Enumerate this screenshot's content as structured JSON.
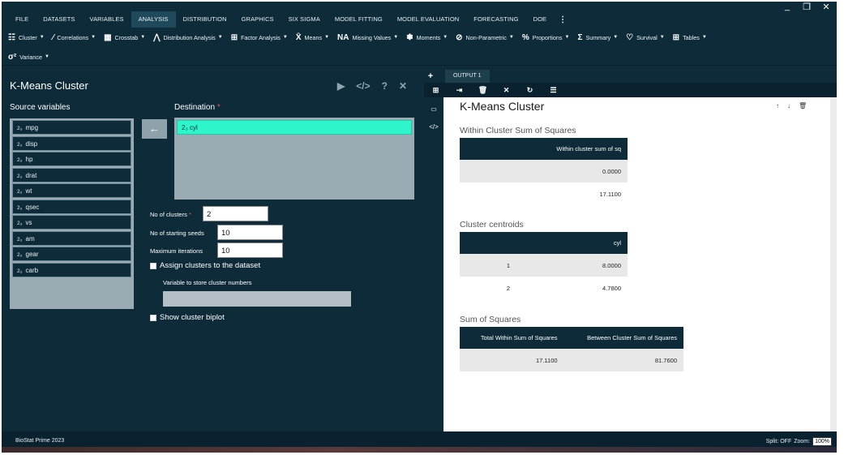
{
  "window_controls": {
    "minimize": "_",
    "maximize": "❐",
    "close": "✕"
  },
  "menu": {
    "items": [
      "FILE",
      "DATASETS",
      "VARIABLES",
      "ANALYSIS",
      "DISTRIBUTION",
      "GRAPHICS",
      "SIX SIGMA",
      "MODEL FITTING",
      "MODEL EVALUATION",
      "FORECASTING",
      "DOE"
    ],
    "active": "ANALYSIS",
    "more": "⋮"
  },
  "ribbon": {
    "row1": [
      {
        "icon": "☷",
        "icon_name": "cluster-icon",
        "label": "Cluster"
      },
      {
        "icon": "∕",
        "icon_name": "correlations-icon",
        "label": "Correlations"
      },
      {
        "icon": "▦",
        "icon_name": "crosstab-icon",
        "label": "Crosstab"
      },
      {
        "icon": "⋀",
        "icon_name": "distribution-analysis-icon",
        "label": "Distribution Analysis"
      },
      {
        "icon": "⊞",
        "icon_name": "factor-analysis-icon",
        "label": "Factor Analysis"
      },
      {
        "icon": "X̄",
        "icon_name": "means-icon",
        "label": "Means"
      },
      {
        "icon": "NA",
        "icon_name": "missing-values-icon",
        "label": "Missing Values"
      },
      {
        "icon": "✽",
        "icon_name": "moments-icon",
        "label": "Moments"
      },
      {
        "icon": "⊘",
        "icon_name": "non-parametric-icon",
        "label": "Non-Parametric"
      },
      {
        "icon": "%",
        "icon_name": "proportions-icon",
        "label": "Proportions"
      },
      {
        "icon": "Σ",
        "icon_name": "summary-icon",
        "label": "Summary"
      },
      {
        "icon": "♡",
        "icon_name": "survival-icon",
        "label": "Survival"
      },
      {
        "icon": "⊞",
        "icon_name": "tables-icon",
        "label": "Tables"
      }
    ],
    "row2": [
      {
        "icon": "σ²",
        "icon_name": "variance-icon",
        "label": "Variance"
      }
    ]
  },
  "dialog": {
    "title": "K-Means Cluster",
    "tools": {
      "run": "▶",
      "code": "</>",
      "help": "?",
      "close": "✕"
    },
    "source_label": "Source variables",
    "destination_label": "Destination",
    "required_mark": "*",
    "var_icon": "2₃",
    "source_variables": [
      "mpg",
      "disp",
      "hp",
      "drat",
      "wt",
      "qsec",
      "vs",
      "am",
      "gear",
      "carb"
    ],
    "destination_variables": [
      "cyl"
    ],
    "move_arrow": "←",
    "no_of_clusters_label": "No of clusters",
    "no_of_clusters_value": "2",
    "no_of_starting_seeds_label": "No of starting seeds",
    "no_of_starting_seeds_value": "10",
    "maximum_iterations_label": "Maximum iterations",
    "maximum_iterations_value": "10",
    "assign_clusters_label": "Assign clusters to the dataset",
    "store_variable_label": "Variable to store cluster numbers",
    "store_variable_value": "",
    "show_biplot_label": "Show cluster biplot"
  },
  "output": {
    "add_tab": "+",
    "tab_label": "OUTPUT 1",
    "toolbar": [
      "⊞",
      "⇥",
      "🗑",
      "✕",
      "↻",
      "☰"
    ],
    "side": [
      "▭",
      "</>"
    ],
    "title": "K-Means Cluster",
    "actions": [
      "↑",
      "↓",
      "🗑"
    ],
    "within": {
      "title": "Within Cluster Sum of Squares",
      "header": "Within cluster sum of sq",
      "rows": [
        "0.0000",
        "17.1100"
      ]
    },
    "centroids": {
      "title": "Cluster centroids",
      "header_index": "",
      "header_value": "cyl",
      "rows": [
        {
          "cluster": "1",
          "value": "8.0000"
        },
        {
          "cluster": "2",
          "value": "4.7800"
        }
      ]
    },
    "ss": {
      "title": "Sum of Squares",
      "header_total": "Total Within Sum of Squares",
      "header_between": "Between Cluster Sum of Squares",
      "total": "17.1100",
      "between": "81.7600"
    }
  },
  "status": {
    "left": "BioStat Prime 2023",
    "split": "Split: OFF",
    "zoom_label": "Zoom:",
    "zoom_value": "100%"
  }
}
